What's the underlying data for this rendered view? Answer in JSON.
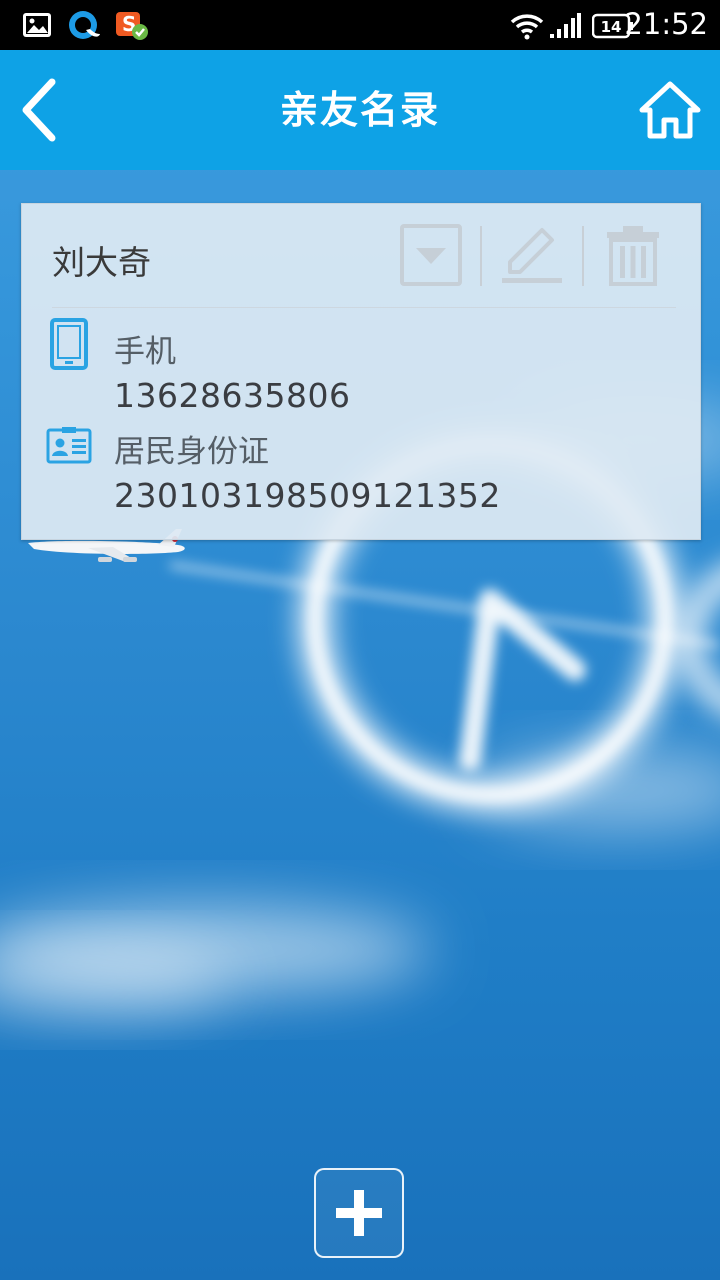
{
  "status_bar": {
    "time": "21:52",
    "battery_level": "14",
    "icons": [
      "gallery-icon",
      "browser-icon",
      "input-method-icon",
      "wifi-icon",
      "signal-icon",
      "battery-icon"
    ]
  },
  "header": {
    "title": "亲友名录",
    "back_icon": "chevron-left-icon",
    "home_icon": "home-icon",
    "background_color": "#0ea2e6"
  },
  "contacts": [
    {
      "name": "刘大奇",
      "actions": [
        "dropdown-icon",
        "edit-icon",
        "trash-icon"
      ],
      "fields": [
        {
          "icon": "phone-icon",
          "label": "手机",
          "value": "13628635806"
        },
        {
          "icon": "id-card-icon",
          "label": "居民身份证",
          "value": "230103198509121352"
        }
      ]
    }
  ],
  "footer": {
    "add_icon": "plus-icon"
  },
  "colors": {
    "accent": "#0ea2e6",
    "card_bg": "#dee9f3",
    "icon_blue": "#2aa3e3"
  }
}
